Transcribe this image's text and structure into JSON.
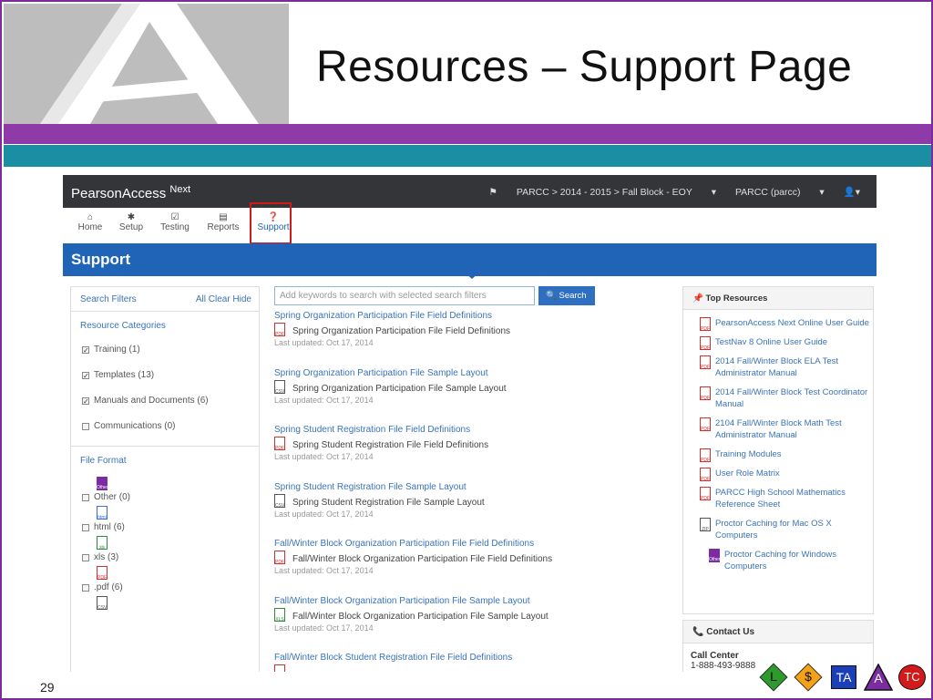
{
  "slide": {
    "title": "Resources – Support Page",
    "page_number": "29",
    "colors": {
      "purple": "#8e3ba9",
      "teal": "#1a8fa3",
      "header_blue": "#1f64b7"
    }
  },
  "app": {
    "brand": "PearsonAccess",
    "brand_sup": "Next",
    "breadcrumb": "PARCC > 2014 - 2015 > Fall Block - EOY",
    "org": "PARCC (parcc)",
    "nav": [
      {
        "label": "Home",
        "icon": "home-icon"
      },
      {
        "label": "Setup",
        "icon": "gear-icon"
      },
      {
        "label": "Testing",
        "icon": "checkbox-icon"
      },
      {
        "label": "Reports",
        "icon": "reports-icon"
      },
      {
        "label": "Support",
        "icon": "question-icon"
      }
    ],
    "page_header": "Support"
  },
  "filters": {
    "title": "Search Filters",
    "links": "All Clear Hide",
    "categories_title": "Resource Categories",
    "categories": [
      {
        "label": "Training (1)",
        "checked": true
      },
      {
        "label": "Templates (13)",
        "checked": true
      },
      {
        "label": "Manuals and Documents (6)",
        "checked": true
      },
      {
        "label": "Communications (0)",
        "checked": false
      }
    ],
    "format_title": "File Format",
    "formats": [
      {
        "label": "Other (0)",
        "icon": "Other"
      },
      {
        "label": "html (6)",
        "icon": "html"
      },
      {
        "label": "xls (3)",
        "icon": "xls"
      },
      {
        "label": ".pdf (6)",
        "icon": "PDF"
      }
    ]
  },
  "search": {
    "placeholder": "Add keywords to search with selected search filters",
    "button": "Search"
  },
  "results": [
    {
      "title": "Spring Organization Participation File Field Definitions",
      "file": "Spring Organization Participation File Field Definitions",
      "type": "PDF",
      "updated": "Last updated: Oct 17, 2014"
    },
    {
      "title": "Spring Organization Participation File Sample Layout",
      "file": "Spring Organization Participation File Sample Layout",
      "type": "CSV",
      "updated": "Last updated: Oct 17, 2014"
    },
    {
      "title": "Spring Student Registration File Field Definitions",
      "file": "Spring Student Registration File Field Definitions",
      "type": "PDF",
      "updated": "Last updated: Oct 17, 2014"
    },
    {
      "title": "Spring Student Registration File Sample Layout",
      "file": "Spring Student Registration File Sample Layout",
      "type": "CSV",
      "updated": "Last updated: Oct 17, 2014"
    },
    {
      "title": "Fall/Winter Block Organization Participation File Field Definitions",
      "file": "Fall/Winter Block Organization Participation File Field Definitions",
      "type": "PDF",
      "updated": "Last updated: Oct 17, 2014"
    },
    {
      "title": "Fall/Winter Block Organization Participation File Sample Layout",
      "file": "Fall/Winter Block Organization Participation File Sample Layout",
      "type": "XLS",
      "updated": "Last updated: Oct 17, 2014"
    },
    {
      "title": "Fall/Winter Block Student Registration File Field Definitions",
      "file": "",
      "type": "PDF",
      "updated": ""
    }
  ],
  "top_resources": {
    "title": "Top Resources",
    "items": [
      {
        "label": "PearsonAccess Next Online User Guide",
        "type": "PDF"
      },
      {
        "label": "TestNav 8 Online User Guide",
        "type": "PDF"
      },
      {
        "label": "2014 Fall/Winter Block ELA Test Administrator Manual",
        "type": "PDF"
      },
      {
        "label": "2014 Fall/Winter Block Test Coordinator Manual",
        "type": "PDF"
      },
      {
        "label": "2104 Fall/Winter Block Math Test Administrator Manual",
        "type": "PDF"
      },
      {
        "label": "Training Modules",
        "type": "PDF"
      },
      {
        "label": "User Role Matrix",
        "type": "PDF"
      },
      {
        "label": "PARCC High School Mathematics Reference Sheet",
        "type": "PDF"
      },
      {
        "label": "Proctor Caching for Mac OS X Computers",
        "type": "ZIP"
      },
      {
        "label": "Proctor Caching for Windows Computers",
        "type": "Other"
      }
    ]
  },
  "contact": {
    "title": "Contact Us",
    "line1": "Call Center",
    "line2": "1-888-493-9888"
  },
  "badges": [
    {
      "label": "L",
      "color": "#2e9a2e"
    },
    {
      "label": "$",
      "color": "#f4a21a"
    },
    {
      "label": "TA",
      "color": "#1a3fb8"
    },
    {
      "label": "A",
      "color": "#7b2ca0"
    },
    {
      "label": "TC",
      "color": "#d31a1a"
    }
  ]
}
